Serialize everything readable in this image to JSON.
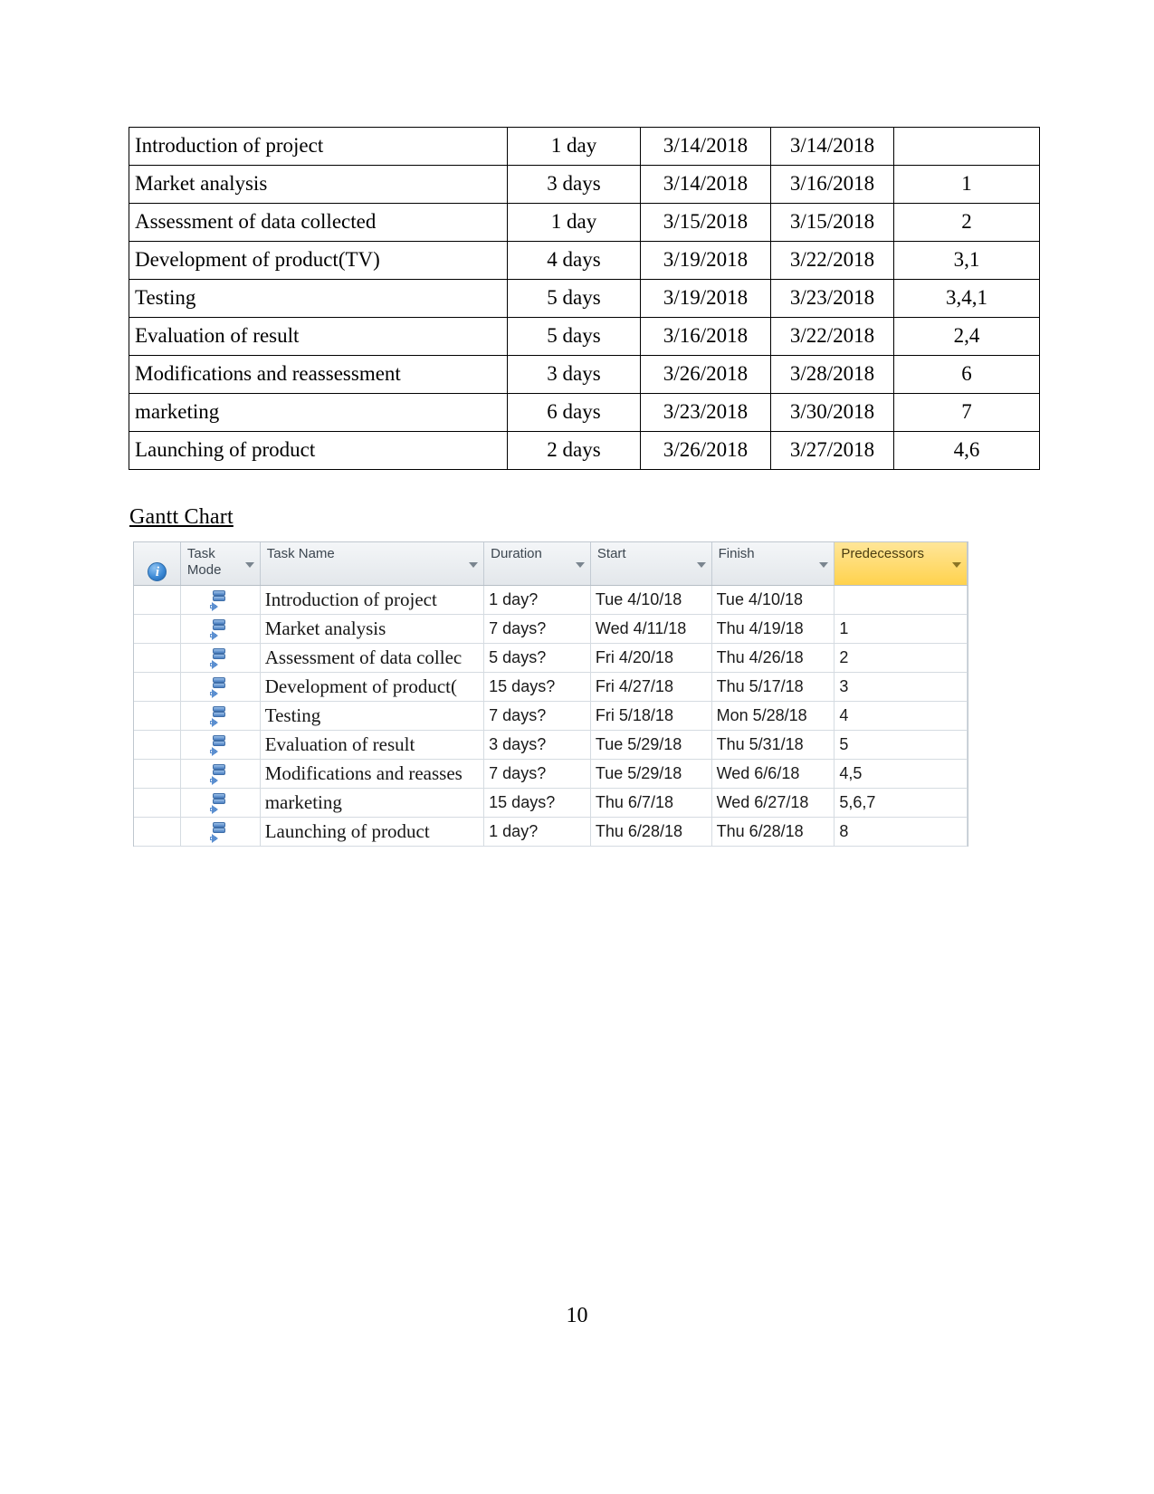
{
  "document": {
    "page_number": "10"
  },
  "schedule_table": {
    "rows": [
      {
        "task": "Introduction of project",
        "duration": "1 day",
        "start": "3/14/2018",
        "finish": "3/14/2018",
        "predecessors": ""
      },
      {
        "task": "Market analysis",
        "duration": "3 days",
        "start": "3/14/2018",
        "finish": "3/16/2018",
        "predecessors": "1"
      },
      {
        "task": "Assessment of data collected",
        "duration": "1 day",
        "start": "3/15/2018",
        "finish": "3/15/2018",
        "predecessors": "2"
      },
      {
        "task": "Development of product(TV)",
        "duration": "4 days",
        "start": "3/19/2018",
        "finish": "3/22/2018",
        "predecessors": "3,1"
      },
      {
        "task": "Testing",
        "duration": "5 days",
        "start": "3/19/2018",
        "finish": "3/23/2018",
        "predecessors": "3,4,1"
      },
      {
        "task": "Evaluation of result",
        "duration": "5 days",
        "start": "3/16/2018",
        "finish": "3/22/2018",
        "predecessors": "2,4"
      },
      {
        "task": "Modifications and reassessment",
        "duration": "3 days",
        "start": "3/26/2018",
        "finish": "3/28/2018",
        "predecessors": "6"
      },
      {
        "task": "marketing",
        "duration": "6 days",
        "start": "3/23/2018",
        "finish": "3/30/2018",
        "predecessors": "7"
      },
      {
        "task": "Launching of product",
        "duration": "2 days",
        "start": "3/26/2018",
        "finish": "3/27/2018",
        "predecessors": "4,6"
      }
    ]
  },
  "gantt_section": {
    "heading": "Gantt Chart",
    "highlight_color": "#ffd24d",
    "header": {
      "info": "i",
      "task_mode": "Task\nMode",
      "task_name": "Task Name",
      "duration": "Duration",
      "start": "Start",
      "finish": "Finish",
      "predecessors": "Predecessors"
    },
    "rows": [
      {
        "name": "Introduction of project",
        "duration": "1 day?",
        "start": "Tue 4/10/18",
        "finish": "Tue 4/10/18",
        "predecessors": ""
      },
      {
        "name": "Market analysis",
        "duration": "7 days?",
        "start": "Wed 4/11/18",
        "finish": "Thu 4/19/18",
        "predecessors": "1"
      },
      {
        "name": "Assessment of data collec",
        "duration": "5 days?",
        "start": "Fri 4/20/18",
        "finish": "Thu 4/26/18",
        "predecessors": "2"
      },
      {
        "name": "Development of product(",
        "duration": "15 days?",
        "start": "Fri 4/27/18",
        "finish": "Thu 5/17/18",
        "predecessors": "3"
      },
      {
        "name": "Testing",
        "duration": "7 days?",
        "start": "Fri 5/18/18",
        "finish": "Mon 5/28/18",
        "predecessors": "4"
      },
      {
        "name": "Evaluation of result",
        "duration": "3 days?",
        "start": "Tue 5/29/18",
        "finish": "Thu 5/31/18",
        "predecessors": "5"
      },
      {
        "name": "Modifications and reasses",
        "duration": "7 days?",
        "start": "Tue 5/29/18",
        "finish": "Wed 6/6/18",
        "predecessors": "4,5"
      },
      {
        "name": "marketing",
        "duration": "15 days?",
        "start": "Thu 6/7/18",
        "finish": "Wed 6/27/18",
        "predecessors": "5,6,7"
      },
      {
        "name": "Launching of product",
        "duration": "1 day?",
        "start": "Thu 6/28/18",
        "finish": "Thu 6/28/18",
        "predecessors": "8"
      }
    ]
  }
}
